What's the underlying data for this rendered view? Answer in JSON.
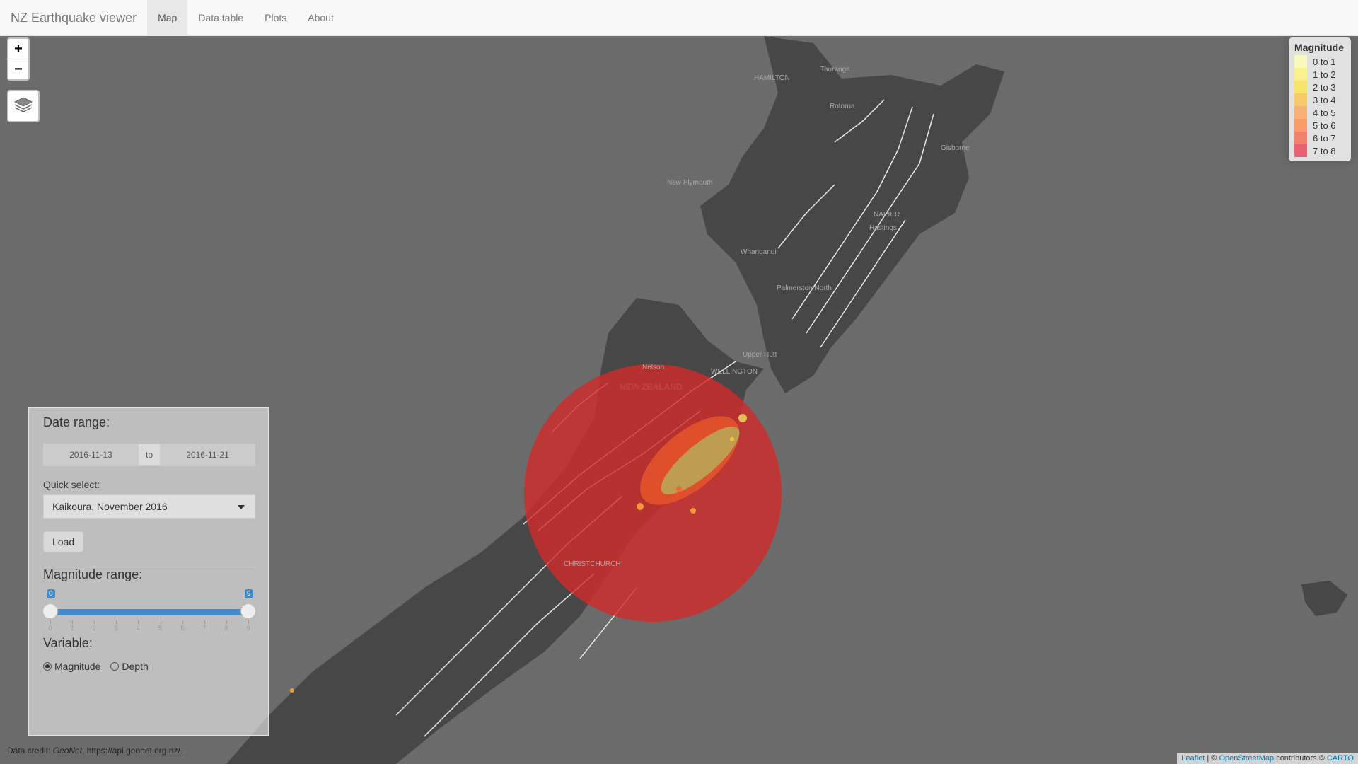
{
  "navbar": {
    "brand": "NZ Earthquake viewer",
    "tabs": [
      {
        "label": "Map",
        "active": true
      },
      {
        "label": "Data table"
      },
      {
        "label": "Plots"
      },
      {
        "label": "About"
      }
    ]
  },
  "map": {
    "zoom_in": "+",
    "zoom_out": "−",
    "layers_icon": "layers-icon",
    "place_labels": [
      "Tauranga",
      "HAMILTON",
      "Rotorua",
      "Gisborne",
      "New Plymouth",
      "NAPIER",
      "Hastings",
      "Whanganui",
      "Palmerston North",
      "Upper Hutt",
      "WELLINGTON",
      "Nelson",
      "NEW ZEALAND",
      "CHRISTCHURCH"
    ],
    "highlight_circle_color": "#d22a2a",
    "quake_colors": [
      "#f8f4a0",
      "#f0e060",
      "#f5c040",
      "#f29a3a",
      "#ee6a30",
      "#e24a2a"
    ]
  },
  "legend": {
    "title": "Magnitude",
    "items": [
      {
        "label": "0 to 1",
        "color": "#ffffb2"
      },
      {
        "label": "1 to 2",
        "color": "#fff37a"
      },
      {
        "label": "2 to 3",
        "color": "#fee34e"
      },
      {
        "label": "3 to 4",
        "color": "#fec44f"
      },
      {
        "label": "4 to 5",
        "color": "#fda45a"
      },
      {
        "label": "5 to 6",
        "color": "#fc8a4a"
      },
      {
        "label": "6 to 7",
        "color": "#f56b4c"
      },
      {
        "label": "7 to 8",
        "color": "#e8425a"
      }
    ]
  },
  "panel": {
    "date_title": "Date range:",
    "date_from": "2016-11-13",
    "date_sep": "to",
    "date_to": "2016-11-21",
    "quick_label": "Quick select:",
    "quick_value": "Kaikoura, November 2016",
    "load_label": "Load",
    "mag_title": "Magnitude range:",
    "mag_min": "0",
    "mag_max": "9",
    "mag_min_value": 0,
    "mag_max_value": 9,
    "ticks": [
      "0",
      "1",
      "2",
      "3",
      "4",
      "5",
      "6",
      "7",
      "8",
      "9"
    ],
    "var_title": "Variable:",
    "radio_magnitude": "Magnitude",
    "radio_depth": "Depth",
    "selected_variable": "Magnitude"
  },
  "credit": {
    "prefix": "Data credit:",
    "source": "GeoNet",
    "suffix": ", https://api.geonet.org.nz/."
  },
  "attribution": {
    "leaflet": "Leaflet",
    "sep": "| ©",
    "osm": "OpenStreetMap",
    "contrib": "contributors ©",
    "carto": "CARTO"
  }
}
